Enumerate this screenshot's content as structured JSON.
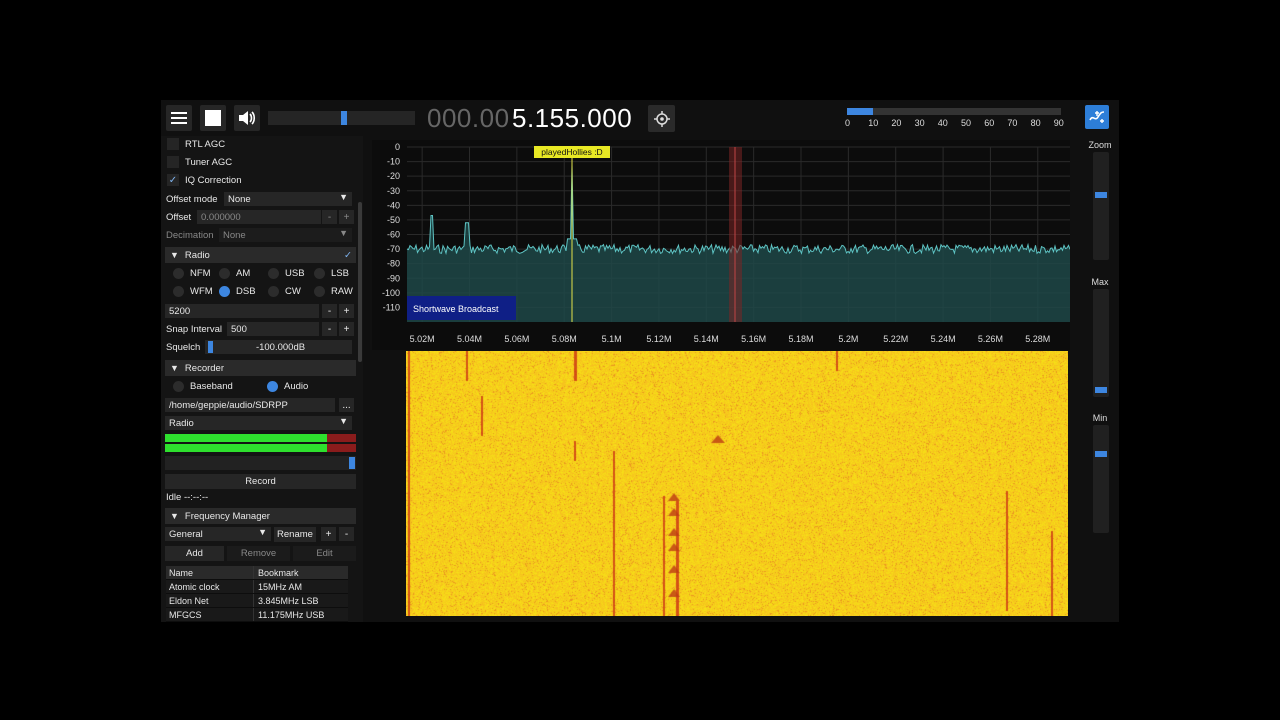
{
  "toolbar": {
    "freq_dim": "000.00",
    "freq_main": "5.155.000",
    "volume_level": 0.52,
    "snr_level": 0.12,
    "snr_ticks": [
      "0",
      "10",
      "20",
      "30",
      "40",
      "50",
      "60",
      "70",
      "80",
      "90"
    ]
  },
  "sidebar": {
    "rtl_agc": "RTL AGC",
    "tuner_agc": "Tuner AGC",
    "iq_correction": "IQ Correction",
    "offset_mode_label": "Offset mode",
    "offset_mode_value": "None",
    "offset_label": "Offset",
    "offset_value": "0.000000",
    "decimation_label": "Decimation",
    "decimation_value": "None",
    "radio": {
      "title": "Radio",
      "modes_row1": [
        "NFM",
        "AM",
        "USB",
        "LSB"
      ],
      "modes_row2": [
        "WFM",
        "DSB",
        "CW",
        "RAW"
      ],
      "selected_mode": "DSB",
      "bandwidth": "5200",
      "snap_label": "Snap Interval",
      "snap_value": "500",
      "squelch_label": "Squelch",
      "squelch_value": "-100.000dB"
    },
    "recorder": {
      "title": "Recorder",
      "baseband": "Baseband",
      "audio": "Audio",
      "path": "/home/geppie/audio/SDRPP",
      "path_btn": "...",
      "stream": "Radio",
      "record": "Record",
      "status": "Idle --:--:--"
    },
    "freq_manager": {
      "title": "Frequency Manager",
      "list": "General",
      "rename": "Rename",
      "plus": "+",
      "minus": "-",
      "add": "Add",
      "remove": "Remove",
      "edit": "Edit",
      "col_name": "Name",
      "col_bookmark": "Bookmark",
      "rows": [
        {
          "name": "Atomic clock",
          "bookmark": "15MHz AM"
        },
        {
          "name": "Eldon Net",
          "bookmark": "3.845MHz LSB"
        },
        {
          "name": "MFGCS",
          "bookmark": "11.175MHz USB"
        }
      ]
    }
  },
  "fft": {
    "y_ticks": [
      "0",
      "-10",
      "-20",
      "-30",
      "-40",
      "-50",
      "-60",
      "-70",
      "-80",
      "-90",
      "-100",
      "-110"
    ],
    "x_ticks": [
      "5.02M",
      "5.04M",
      "5.06M",
      "5.08M",
      "5.1M",
      "5.12M",
      "5.14M",
      "5.16M",
      "5.18M",
      "5.2M",
      "5.22M",
      "5.24M",
      "5.26M",
      "5.28M"
    ],
    "band_label": "Shortwave Broadcast",
    "marker_label": "playedHollies :D"
  },
  "right_panel": {
    "zoom": "Zoom",
    "max": "Max",
    "min": "Min"
  },
  "colors": {
    "accent": "#3d86e0",
    "waterfall_bg": "#f3e41f",
    "spectrum_line": "#5ec4c4"
  }
}
